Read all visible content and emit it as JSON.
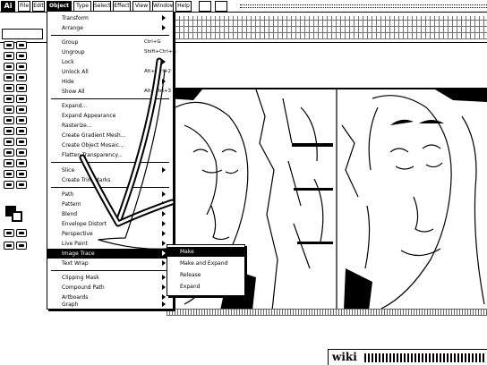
{
  "app": {
    "logo_text": "Ai"
  },
  "menubar": {
    "items": [
      {
        "label": "File"
      },
      {
        "label": "Edit"
      },
      {
        "label": "Object"
      },
      {
        "label": "Type"
      },
      {
        "label": "Select"
      },
      {
        "label": "Effect"
      },
      {
        "label": "View"
      },
      {
        "label": "Window"
      },
      {
        "label": "Help"
      }
    ]
  },
  "object_menu": {
    "items": [
      {
        "label": "Transform",
        "shortcut": "",
        "submenu": true
      },
      {
        "label": "Arrange",
        "shortcut": "",
        "submenu": true
      },
      {
        "separator": true
      },
      {
        "label": "Group",
        "shortcut": "Ctrl+G",
        "submenu": false
      },
      {
        "label": "Ungroup",
        "shortcut": "Shift+Ctrl+G",
        "submenu": false
      },
      {
        "label": "Lock",
        "shortcut": "",
        "submenu": true
      },
      {
        "label": "Unlock All",
        "shortcut": "Alt+Ctrl+2",
        "submenu": false
      },
      {
        "label": "Hide",
        "shortcut": "",
        "submenu": true
      },
      {
        "label": "Show All",
        "shortcut": "Alt+Ctrl+3",
        "submenu": false
      },
      {
        "separator": true
      },
      {
        "label": "Expand...",
        "shortcut": "",
        "submenu": false
      },
      {
        "label": "Expand Appearance",
        "shortcut": "",
        "submenu": false
      },
      {
        "label": "Rasterize...",
        "shortcut": "",
        "submenu": false
      },
      {
        "label": "Create Gradient Mesh...",
        "shortcut": "",
        "submenu": false
      },
      {
        "label": "Create Object Mosaic...",
        "shortcut": "",
        "submenu": false
      },
      {
        "label": "Flatten Transparency...",
        "shortcut": "",
        "submenu": false
      },
      {
        "separator": true
      },
      {
        "label": "Slice",
        "shortcut": "",
        "submenu": true
      },
      {
        "label": "Create Trim Marks",
        "shortcut": "",
        "submenu": false
      },
      {
        "separator": true
      },
      {
        "label": "Path",
        "shortcut": "",
        "submenu": true
      },
      {
        "label": "Pattern",
        "shortcut": "",
        "submenu": true
      },
      {
        "label": "Blend",
        "shortcut": "",
        "submenu": true
      },
      {
        "label": "Envelope Distort",
        "shortcut": "",
        "submenu": true
      },
      {
        "label": "Perspective",
        "shortcut": "",
        "submenu": true
      },
      {
        "label": "Live Paint",
        "shortcut": "",
        "submenu": true
      },
      {
        "label": "Image Trace",
        "shortcut": "",
        "submenu": true,
        "highlighted": true
      },
      {
        "label": "Text Wrap",
        "shortcut": "",
        "submenu": true
      },
      {
        "separator": true
      },
      {
        "label": "Clipping Mask",
        "shortcut": "",
        "submenu": true
      },
      {
        "label": "Compound Path",
        "shortcut": "",
        "submenu": true
      },
      {
        "label": "Artboards",
        "shortcut": "",
        "submenu": true
      },
      {
        "label": "Graph",
        "shortcut": "",
        "submenu": true
      }
    ]
  },
  "image_trace_submenu": {
    "items": [
      {
        "label": "Make",
        "highlighted": true
      },
      {
        "label": "Make and Expand",
        "highlighted": false
      },
      {
        "label": "Release",
        "highlighted": false
      },
      {
        "label": "Expand",
        "highlighted": false
      }
    ]
  },
  "watermark": {
    "text": "wiki"
  }
}
